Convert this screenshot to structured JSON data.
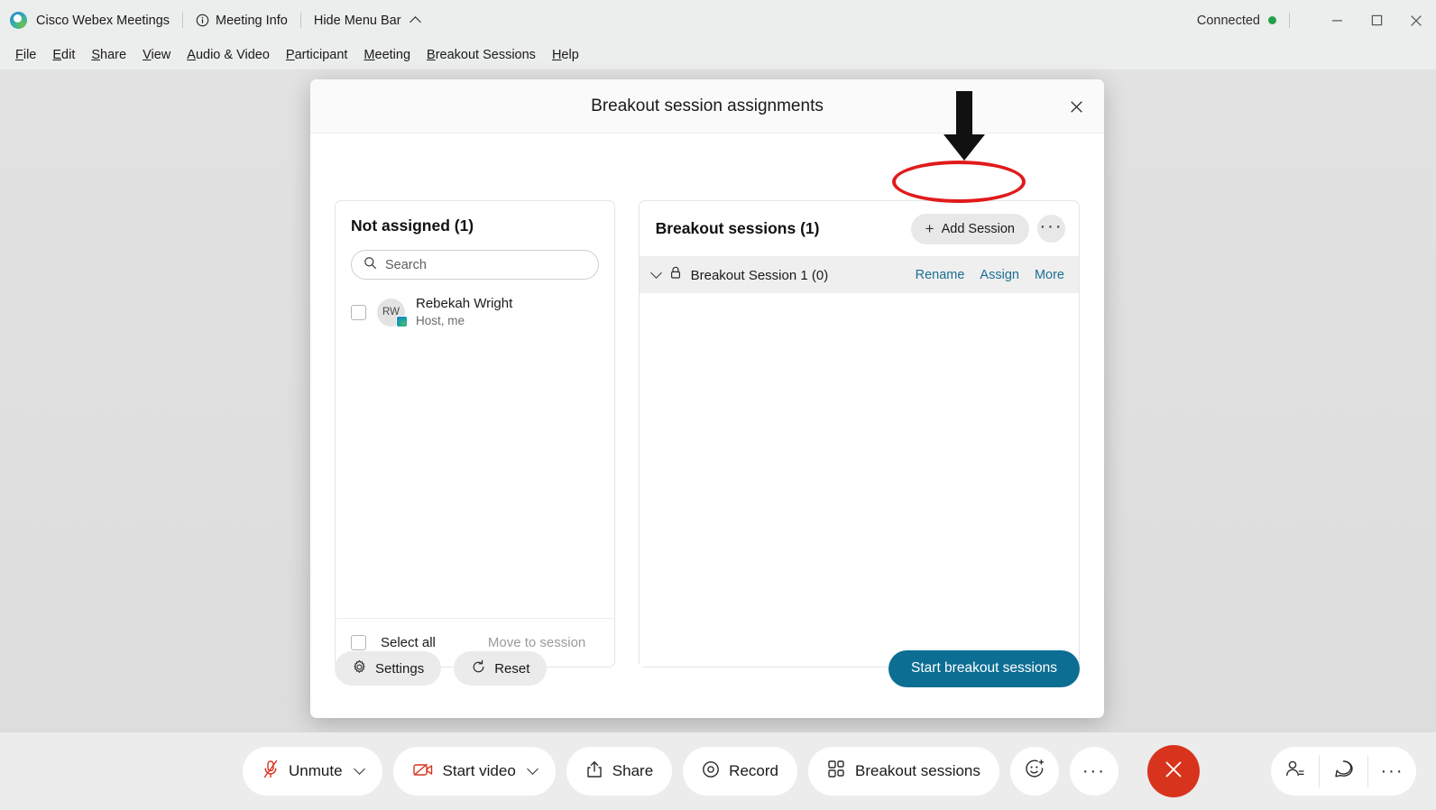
{
  "titlebar": {
    "logo_icon": "webex-logo-icon",
    "app_name": "Cisco Webex Meetings",
    "meeting_info_icon": "info-circle-icon",
    "meeting_info_label": "Meeting Info",
    "hide_menu_label": "Hide Menu Bar",
    "hide_menu_icon": "chevron-up-icon",
    "connection_status": "Connected",
    "connection_color": "#24a148",
    "window_controls": [
      "minimize",
      "maximize",
      "close"
    ]
  },
  "menubar": {
    "items": [
      {
        "label": "File",
        "accel": "F",
        "rest": "ile"
      },
      {
        "label": "Edit",
        "accel": "E",
        "rest": "dit"
      },
      {
        "label": "Share",
        "accel": "S",
        "rest": "hare"
      },
      {
        "label": "View",
        "accel": "V",
        "rest": "iew"
      },
      {
        "label": "Audio & Video",
        "accel": "A",
        "rest": "udio & Video"
      },
      {
        "label": "Participant",
        "accel": "P",
        "rest": "articipant"
      },
      {
        "label": "Meeting",
        "accel": "M",
        "rest": "eeting"
      },
      {
        "label": "Breakout Sessions",
        "accel": "B",
        "rest": "reakout Sessions"
      },
      {
        "label": "Help",
        "accel": "H",
        "rest": "elp"
      }
    ]
  },
  "dialog": {
    "title": "Breakout session assignments",
    "close_icon": "close-icon",
    "not_assigned": {
      "title": "Not assigned (1)",
      "search_placeholder": "Search",
      "search_value": "",
      "search_icon": "search-icon",
      "participants": [
        {
          "initials": "RW",
          "name": "Rebekah Wright",
          "role": "Host, me",
          "checked": false
        }
      ],
      "select_all_label": "Select all",
      "select_all_checked": false,
      "move_to_session_label": "Move to session",
      "move_to_session_enabled": false
    },
    "breakout": {
      "title": "Breakout sessions  (1)",
      "add_session_label": "Add Session",
      "add_session_icon": "plus-icon",
      "more_options_icon": "kebab-icon",
      "sessions": [
        {
          "expand_icon": "chevron-down-icon",
          "lock_icon": "lock-icon",
          "name": "Breakout Session 1 (0)",
          "links": [
            "Rename",
            "Assign",
            "More"
          ]
        }
      ]
    },
    "footer": {
      "settings_label": "Settings",
      "settings_icon": "gear-icon",
      "reset_label": "Reset",
      "reset_icon": "refresh-icon",
      "start_label": "Start breakout sessions",
      "start_color": "#0d6e94"
    }
  },
  "annotations": {
    "highlight_color": "#e01b1b",
    "arrow_color": "#111111",
    "target": "Add Session"
  },
  "toolbar": {
    "controls": [
      {
        "label": "Unmute",
        "icon": "mic-muted-icon",
        "has_dropdown": true,
        "icon_color": "#d8341d"
      },
      {
        "label": "Start video",
        "icon": "camera-off-icon",
        "has_dropdown": true,
        "icon_color": "#d8341d"
      },
      {
        "label": "Share",
        "icon": "share-upload-icon",
        "has_dropdown": false,
        "icon_color": "#2b2b2b"
      },
      {
        "label": "Record",
        "icon": "record-icon",
        "has_dropdown": false,
        "icon_color": "#2b2b2b"
      },
      {
        "label": "Breakout sessions",
        "icon": "grid-icon",
        "has_dropdown": false,
        "icon_color": "#2b2b2b"
      }
    ],
    "reactions_icon": "reactions-smiley-icon",
    "more_icon": "more-horizontal-icon",
    "end_meeting_icon": "end-call-icon",
    "end_meeting_color": "#d8341d",
    "right_group": [
      "participants-icon",
      "chat-icon",
      "more-horizontal-icon"
    ]
  }
}
